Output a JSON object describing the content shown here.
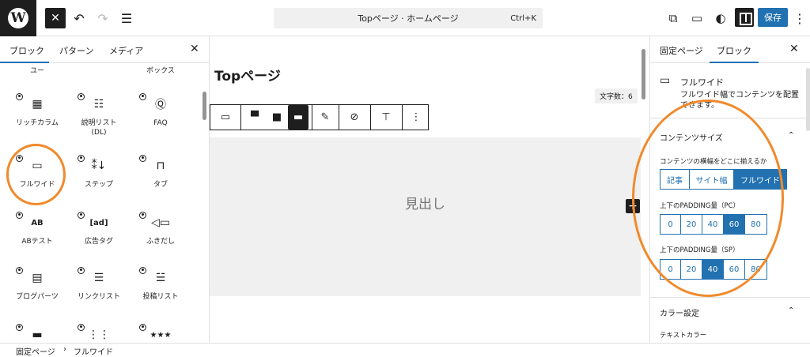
{
  "topbar": {
    "logo": "W",
    "command_text": "Topページ · ホームページ",
    "shortcut": "Ctrl+K",
    "save_label": "保存",
    "icons": [
      "close-icon",
      "undo-icon",
      "redo-icon",
      "document-overview-icon",
      "external-link-icon",
      "device-preview-icon",
      "style-icon",
      "settings-icon",
      "more-vertical-icon"
    ]
  },
  "inserter": {
    "tabs": [
      "ブロック",
      "パターン",
      "メディア"
    ],
    "partial_labels": [
      "ユー",
      "ボックス"
    ],
    "items": [
      {
        "label": "リッチカラム",
        "icon": "grid-icon"
      },
      {
        "label": "説明リスト\n(DL)",
        "icon": "list-table-icon"
      },
      {
        "label": "FAQ",
        "icon": "faq-icon"
      },
      {
        "label": "フルワイド",
        "icon": "fullwide-icon"
      },
      {
        "label": "ステップ",
        "icon": "step-icon"
      },
      {
        "label": "タブ",
        "icon": "tab-icon"
      },
      {
        "label": "ABテスト",
        "icon": "ab-test-icon"
      },
      {
        "label": "広告タグ",
        "icon": "ad-icon"
      },
      {
        "label": "ふきだし",
        "icon": "balloon-icon"
      },
      {
        "label": "ブログパーツ",
        "icon": "blog-parts-icon"
      },
      {
        "label": "リンクリスト",
        "icon": "link-list-icon"
      },
      {
        "label": "投稿リスト",
        "icon": "post-list-icon"
      }
    ]
  },
  "editor": {
    "title": "Topページ",
    "wordcount": "文字数：6",
    "heading_placeholder": "見出し"
  },
  "sidebar": {
    "tabs": [
      "固定ページ",
      "ブロック"
    ],
    "block_name": "フルワイド",
    "block_desc": "フルワイド幅でコンテンツを配置できます。",
    "content_size_title": "コンテンツサイズ",
    "align_label": "コンテンツの横幅をどこに揃えるか",
    "align_options": [
      "記事",
      "サイト幅",
      "フルワイド"
    ],
    "align_selected": 2,
    "pc_label": "上下のPADDING量（PC）",
    "pc_options": [
      "0",
      "20",
      "40",
      "60",
      "80"
    ],
    "pc_selected": 3,
    "sp_label": "上下のPADDING量（SP）",
    "sp_options": [
      "0",
      "20",
      "40",
      "60",
      "80"
    ],
    "sp_selected": 2,
    "color_title": "カラー設定",
    "text_color_label": "テキストカラー"
  },
  "footer": {
    "crumbs": [
      "固定ページ",
      "フルワイド"
    ],
    "separator": "›"
  },
  "colors": {
    "accent": "#2271b1",
    "annotation": "#f08a2c"
  }
}
